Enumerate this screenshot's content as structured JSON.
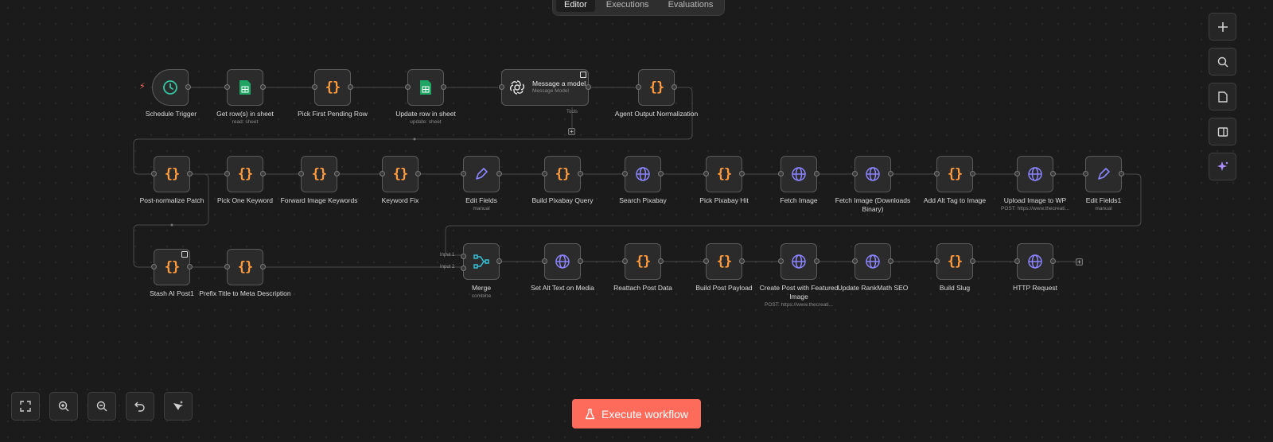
{
  "tabs": [
    "Editor",
    "Executions",
    "Evaluations"
  ],
  "active_tab": "Editor",
  "tools_label": "Tools",
  "nodes": {
    "schedule": {
      "label": "Schedule Trigger",
      "sub": ""
    },
    "getrows": {
      "label": "Get row(s) in sheet",
      "sub": "read: sheet"
    },
    "pickfirst": {
      "label": "Pick First Pending Row",
      "sub": ""
    },
    "updaterow": {
      "label": "Update row in sheet",
      "sub": "update: sheet"
    },
    "message": {
      "label": "Message a model",
      "sub": "Message Model"
    },
    "agentnorm": {
      "label": "Agent Output Normalization",
      "sub": ""
    },
    "postnorm": {
      "label": "Post-normalize Patch",
      "sub": ""
    },
    "pickone": {
      "label": "Pick One Keyword",
      "sub": ""
    },
    "fwdimg": {
      "label": "Forward Image Keywords",
      "sub": ""
    },
    "kwfix": {
      "label": "Keyword Fix",
      "sub": ""
    },
    "editfields": {
      "label": "Edit Fields",
      "sub": "manual"
    },
    "buildpix": {
      "label": "Build Pixabay Query",
      "sub": ""
    },
    "searchpix": {
      "label": "Search Pixabay",
      "sub": ""
    },
    "pickpix": {
      "label": "Pick Pixabay Hit",
      "sub": ""
    },
    "fetchimg": {
      "label": "Fetch Image",
      "sub": ""
    },
    "fetchbin": {
      "label": "Fetch Image (Downloads Binary)",
      "sub": ""
    },
    "addalt": {
      "label": "Add Alt Tag to Image",
      "sub": ""
    },
    "uploadwp": {
      "label": "Upload Image to WP",
      "sub": "POST: https://www.thecreati..."
    },
    "editfields1": {
      "label": "Edit Fields1",
      "sub": "manual"
    },
    "stash": {
      "label": "Stash AI Post1",
      "sub": ""
    },
    "prefix": {
      "label": "Prefix Title to Meta Description",
      "sub": ""
    },
    "merge": {
      "label": "Merge",
      "sub": "combine",
      "input1": "Input 1",
      "input2": "Input 2"
    },
    "setalt": {
      "label": "Set Alt Text on Media",
      "sub": ""
    },
    "reattach": {
      "label": "Reattach Post Data",
      "sub": ""
    },
    "buildpost": {
      "label": "Build Post Payload",
      "sub": ""
    },
    "createpost": {
      "label": "Create Post with Featured Image",
      "sub": "POST: https://www.thecreati..."
    },
    "rankmath": {
      "label": "Update RankMath SEO",
      "sub": ""
    },
    "slug": {
      "label": "Build Slug",
      "sub": ""
    },
    "http": {
      "label": "HTTP Request",
      "sub": ""
    }
  },
  "execute_label": "Execute workflow",
  "colors": {
    "accent": "#ff6b5b",
    "code_orange": "#ff9b3d",
    "http_purple": "#8c85ff",
    "sheets_green": "#1fa463",
    "trigger_teal": "#35c4a0",
    "merge_teal": "#38c0d6"
  },
  "icons": {
    "sidebar": [
      "plus-icon",
      "search-icon",
      "sticky-note-icon",
      "panel-icon",
      "sparkle-icon"
    ],
    "bottom": [
      "fit-view-icon",
      "zoom-in-icon",
      "zoom-out-icon",
      "undo-icon",
      "tidy-up-icon"
    ]
  }
}
